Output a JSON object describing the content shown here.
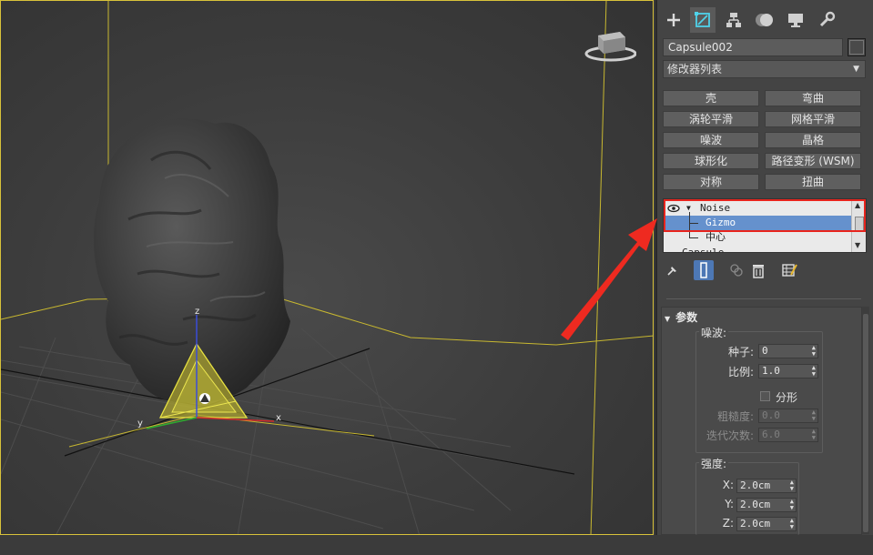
{
  "command_panel": {
    "tabs": [
      {
        "name": "create-icon"
      },
      {
        "name": "modify-icon",
        "active": true
      },
      {
        "name": "hierarchy-icon"
      },
      {
        "name": "motion-icon"
      },
      {
        "name": "display-icon"
      },
      {
        "name": "utilities-icon"
      }
    ],
    "object_name": "Capsule002",
    "modifier_list": "修改器列表",
    "modifier_buttons": [
      "壳",
      "弯曲",
      "涡轮平滑",
      "网格平滑",
      "噪波",
      "晶格",
      "球形化",
      "路径变形 (WSM)",
      "对称",
      "扭曲"
    ],
    "stack": {
      "items": [
        {
          "label": "Noise",
          "level": 0
        },
        {
          "label": "Gizmo",
          "level": 1,
          "selected": true
        },
        {
          "label": "中心",
          "level": 1
        },
        {
          "label": "Capsule",
          "level": 0
        }
      ]
    },
    "rollout": {
      "title": "参数",
      "noise_group": "噪波:",
      "seed_label": "种子:",
      "seed_value": "0",
      "scale_label": "比例:",
      "scale_value": "1.0",
      "fractal_label": "分形",
      "roughness_label": "粗糙度:",
      "roughness_value": "0.0",
      "iterations_label": "迭代次数:",
      "iterations_value": "6.0",
      "strength_group": "强度:",
      "x_label": "X:",
      "x_value": "2.0cm",
      "y_label": "Y:",
      "y_value": "2.0cm",
      "z_label": "Z:",
      "z_value": "2.0cm"
    }
  },
  "viewport": {
    "axis_labels": {
      "x": "x",
      "y": "y",
      "z": "z"
    }
  },
  "colors": {
    "viewport_border": "#d8c23a",
    "selection_highlight": "#6591cd",
    "annotation_red": "#e8241d",
    "gizmo_yellow": "#d4cf2a"
  }
}
